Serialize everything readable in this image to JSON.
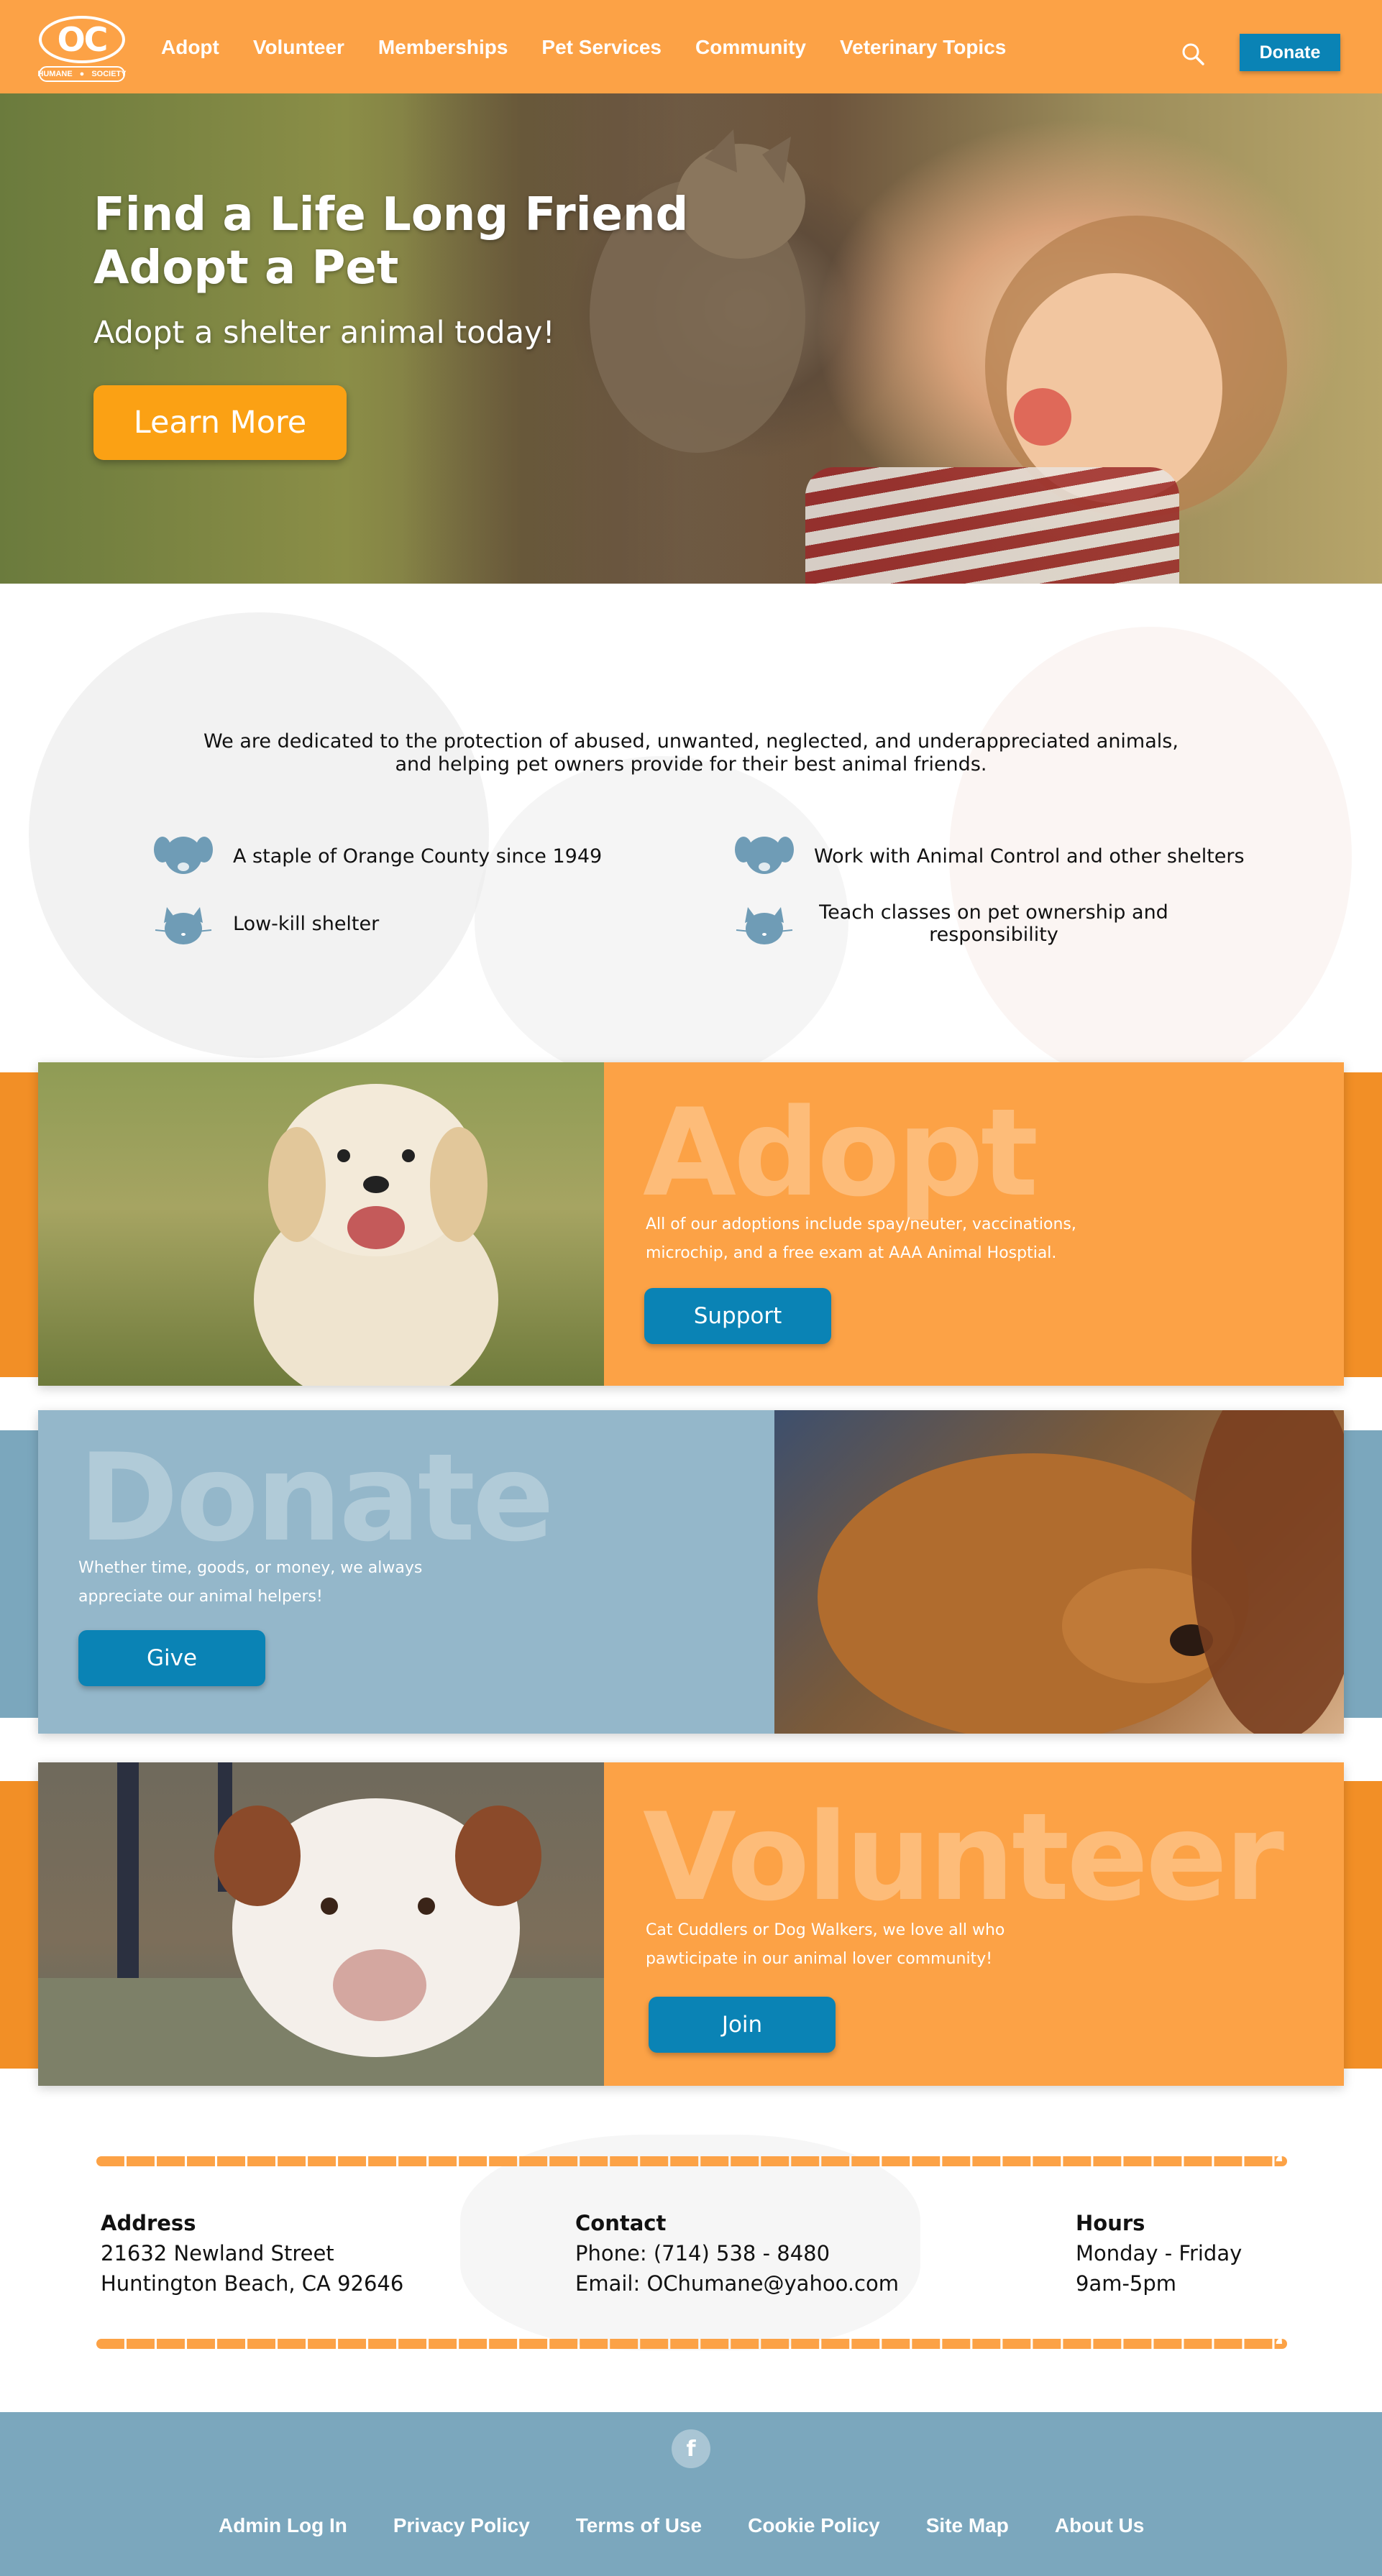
{
  "nav": {
    "logo": {
      "mark": "OC",
      "left": "HUMANE",
      "right": "SOCIETY"
    },
    "links": [
      "Adopt",
      "Volunteer",
      "Memberships",
      "Pet Services",
      "Community",
      "Veterinary Topics"
    ],
    "donate_label": "Donate",
    "search_icon": "search-icon"
  },
  "hero": {
    "title_line1": "Find a Life Long Friend",
    "title_line2": "Adopt a Pet",
    "subtitle": "Adopt a shelter animal today!",
    "button_label": "Learn More"
  },
  "mission": {
    "text": "We are dedicated to the protection of abused, unwanted, neglected, and underappreciated animals, and helping pet owners provide for their best animal friends.",
    "features": [
      {
        "icon": "dog-icon",
        "text": "A staple of Orange County since 1949"
      },
      {
        "icon": "dog-icon",
        "text": "Work with Animal Control and other shelters"
      },
      {
        "icon": "cat-icon",
        "text": "Low-kill shelter"
      },
      {
        "icon": "cat-icon",
        "text": "Teach classes on pet ownership and responsibility"
      }
    ]
  },
  "cards": {
    "adopt": {
      "heading": "Adopt",
      "text": "All of our adoptions include spay/neuter, vaccinations, microchip, and a free exam at AAA Animal Hosptial.",
      "button": "Support"
    },
    "donate": {
      "heading": "Donate",
      "text": "Whether time, goods, or money, we always appreciate our animal helpers!",
      "button": "Give"
    },
    "volunteer": {
      "heading": "Volunteer",
      "text": "Cat Cuddlers or Dog Walkers, we love all who pawticipate in our animal lover community!",
      "button": "Join"
    }
  },
  "contact": {
    "address": {
      "heading": "Address",
      "line1": "21632 Newland Street",
      "line2": "Huntington Beach, CA 92646"
    },
    "contact": {
      "heading": "Contact",
      "line1": "Phone: (714) 538 - 8480",
      "line2": "Email: OChumane@yahoo.com"
    },
    "hours": {
      "heading": "Hours",
      "line1": "Monday - Friday",
      "line2": "9am-5pm"
    }
  },
  "footer": {
    "social_icon": "facebook-icon",
    "social_glyph": "f",
    "links": [
      "Admin Log In",
      "Privacy Policy",
      "Terms of Use",
      "Cookie Policy",
      "Site Map",
      "About Us"
    ]
  },
  "colors": {
    "orange": "#fca246",
    "blue_button": "#0a83b5",
    "slate_blue": "#7ba7bd",
    "light_blue": "#94b7ca"
  }
}
